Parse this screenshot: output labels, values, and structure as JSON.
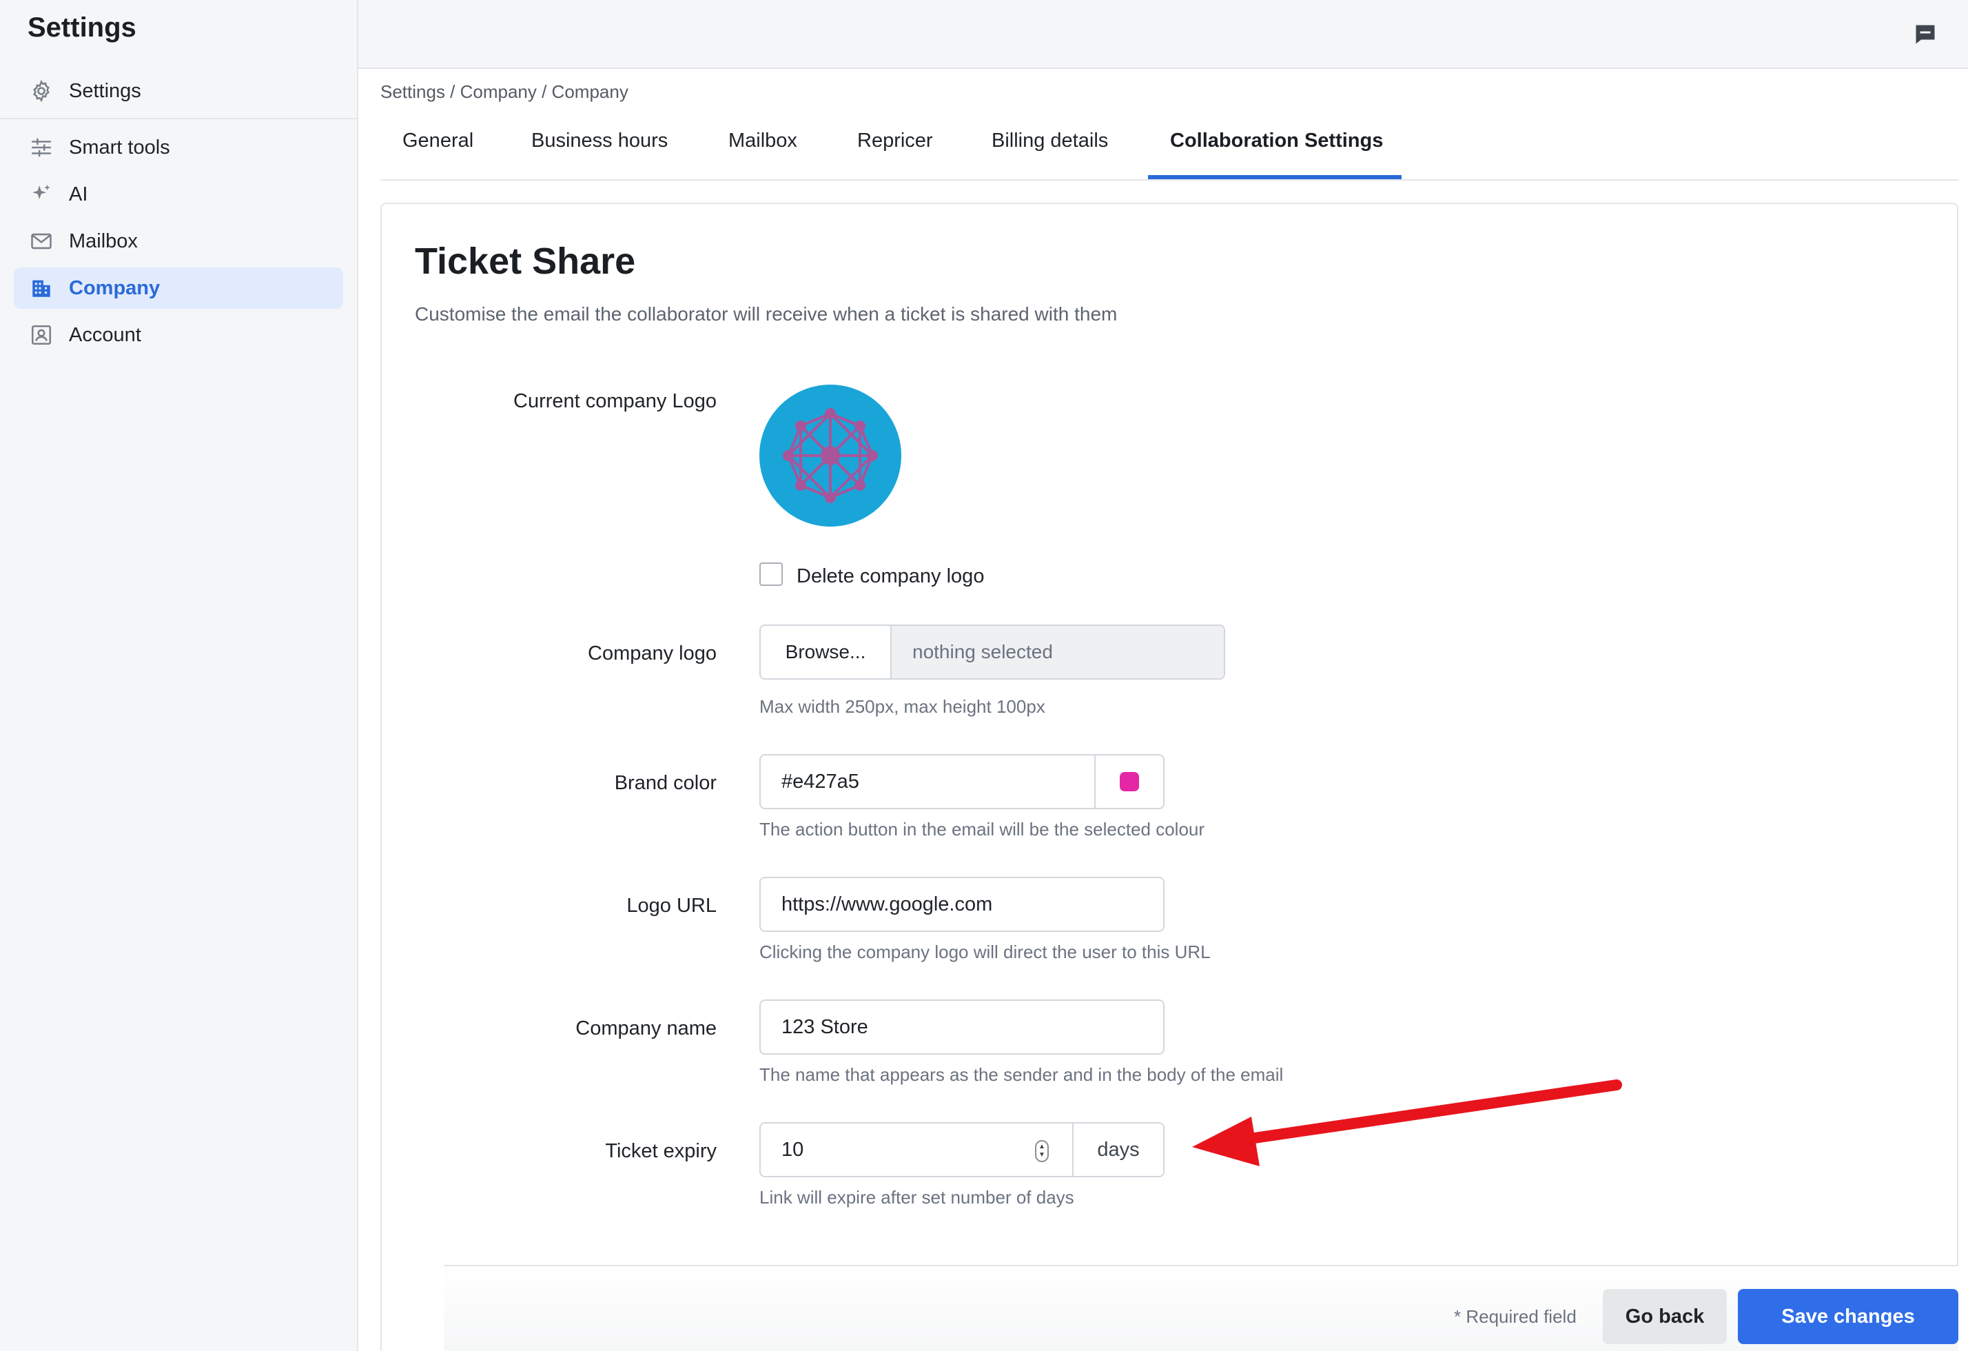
{
  "sidebar": {
    "title": "Settings",
    "items": [
      {
        "label": "Settings",
        "icon": "gear-icon"
      },
      {
        "label": "Smart tools",
        "icon": "sliders-icon"
      },
      {
        "label": "AI",
        "icon": "sparkle-icon"
      },
      {
        "label": "Mailbox",
        "icon": "envelope-icon"
      },
      {
        "label": "Company",
        "icon": "building-icon",
        "active": true
      },
      {
        "label": "Account",
        "icon": "user-card-icon"
      }
    ]
  },
  "topbar": {
    "chat_icon": "chat-icon"
  },
  "breadcrumb": "Settings / Company / Company",
  "tabs": [
    {
      "label": "General"
    },
    {
      "label": "Business hours"
    },
    {
      "label": "Mailbox"
    },
    {
      "label": "Repricer"
    },
    {
      "label": "Billing details"
    },
    {
      "label": "Collaboration Settings",
      "active": true
    }
  ],
  "section": {
    "title": "Ticket Share",
    "subtitle": "Customise the email the collaborator will receive when a ticket is shared with them"
  },
  "form": {
    "current_logo": {
      "label": "Current company Logo"
    },
    "delete_logo": {
      "label": "Delete company logo",
      "checked": false
    },
    "company_logo": {
      "label": "Company logo",
      "browse_label": "Browse...",
      "file_value": "nothing selected",
      "help": "Max width 250px, max height 100px"
    },
    "brand_color": {
      "label": "Brand color",
      "value": "#e427a5",
      "swatch": "#e427a5",
      "help": "The action button in the email will be the selected colour"
    },
    "logo_url": {
      "label": "Logo URL",
      "value": "https://www.google.com",
      "help": "Clicking the company logo will direct the user to this URL"
    },
    "company_name": {
      "label": "Company name",
      "value": "123 Store",
      "help": "The name that appears as the sender and in the body of the email"
    },
    "ticket_expiry": {
      "label": "Ticket expiry",
      "value": "10",
      "unit": "days",
      "help": "Link will expire after set number of days"
    }
  },
  "footer": {
    "required_note": "* Required field",
    "back_label": "Go back",
    "save_label": "Save changes"
  },
  "colors": {
    "accent": "#2a6ad8",
    "primary_button": "#2f6ee8",
    "annotation_arrow": "#e8141c",
    "logo_bg": "#1aa5d9",
    "logo_nodes": "#a8559a"
  }
}
